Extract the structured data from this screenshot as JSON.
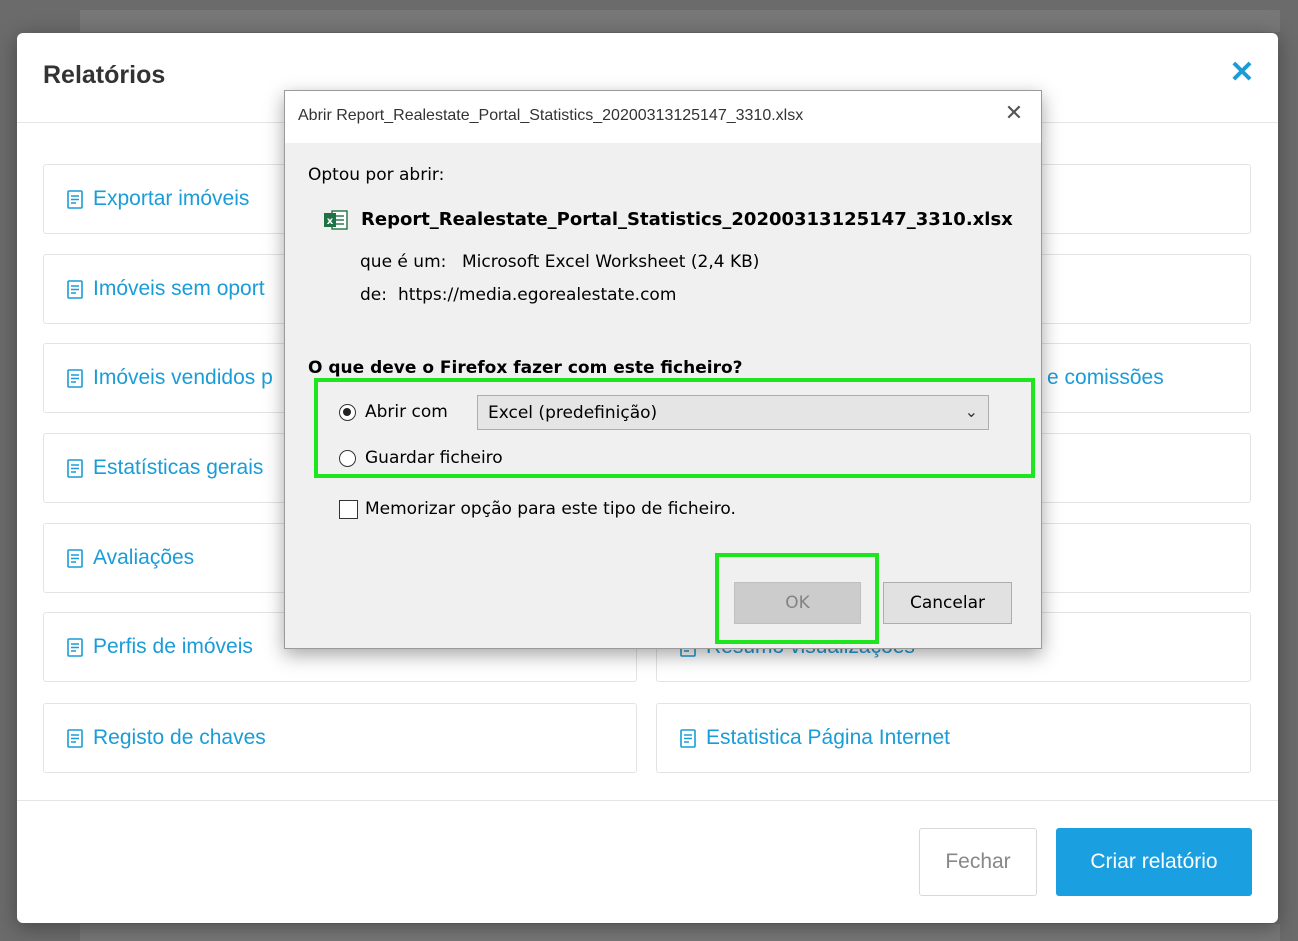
{
  "modal": {
    "title": "Relatórios",
    "close_icon": "close-icon",
    "reports": [
      {
        "label": "Exportar imóveis"
      },
      {
        "label": "Imóveis sem oport"
      },
      {
        "label": "Imóveis vendidos p"
      },
      {
        "label": "Estatísticas gerais"
      },
      {
        "label": "Avaliações"
      },
      {
        "label": "Perfis de imóveis"
      },
      {
        "label": "Registo de chaves"
      },
      {
        "label": "e comissões"
      },
      {
        "label": "Resumo visualizações"
      },
      {
        "label": "Estatistica Página Internet"
      }
    ],
    "footer": {
      "close_label": "Fechar",
      "create_label": "Criar relatório"
    }
  },
  "dialog": {
    "title": "Abrir Report_Realestate_Portal_Statistics_20200313125147_3310.xlsx",
    "chose_to_open": "Optou por abrir:",
    "filename": "Report_Realestate_Portal_Statistics_20200313125147_3310.xlsx",
    "type_label": "que é um:",
    "type_value": "Microsoft Excel Worksheet (2,4 KB)",
    "from_label": "de:",
    "from_value": "https://media.egorealestate.com",
    "question": "O que deve o Firefox fazer com este ficheiro?",
    "open_with_label": "Abrir com",
    "open_with_value": "Excel (predefinição)",
    "save_file_label": "Guardar ficheiro",
    "remember_label": "Memorizar opção para este tipo de ficheiro.",
    "ok_label": "OK",
    "cancel_label": "Cancelar"
  },
  "colors": {
    "accent": "#1a9cd8",
    "highlight": "#1ee61e"
  }
}
